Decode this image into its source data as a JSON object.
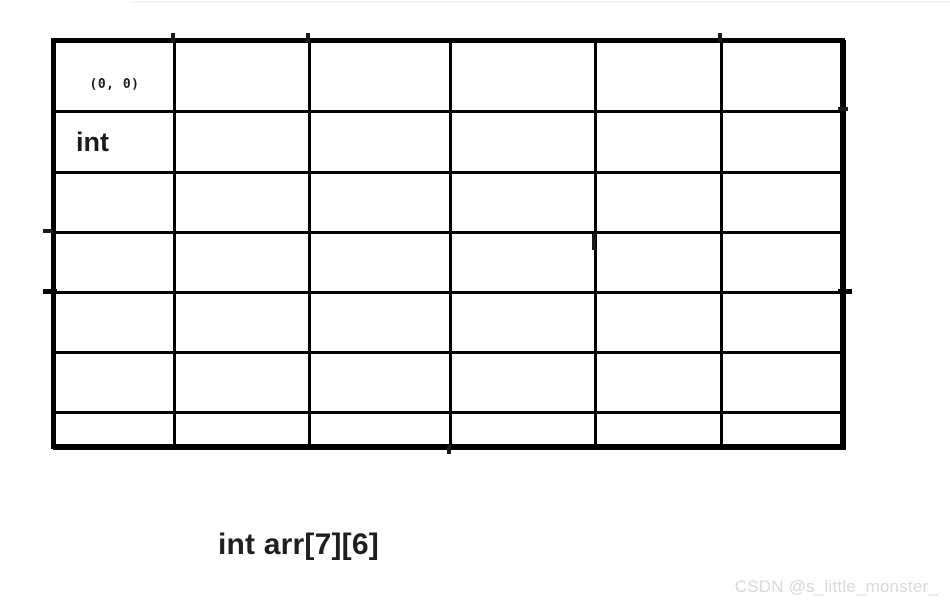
{
  "figure": {
    "caption": "int arr[7][6]",
    "watermark": "CSDN @s_little_monster_",
    "background_color": "#ffffff",
    "line_color": "#000000",
    "text_color": "#1b1b1b",
    "watermark_color": "#d6d9de"
  },
  "grid": {
    "rows": 7,
    "columns": 6,
    "origin_label": "(0, 0)",
    "type_label": "int",
    "cells": [
      [
        {
          "label": "(0, 0)",
          "style": "origin"
        },
        {
          "label": ""
        },
        {
          "label": ""
        },
        {
          "label": ""
        },
        {
          "label": ""
        },
        {
          "label": ""
        }
      ],
      [
        {
          "label": "int",
          "style": "type"
        },
        {
          "label": ""
        },
        {
          "label": ""
        },
        {
          "label": ""
        },
        {
          "label": ""
        },
        {
          "label": ""
        }
      ],
      [
        {
          "label": ""
        },
        {
          "label": ""
        },
        {
          "label": ""
        },
        {
          "label": ""
        },
        {
          "label": ""
        },
        {
          "label": ""
        }
      ],
      [
        {
          "label": ""
        },
        {
          "label": ""
        },
        {
          "label": ""
        },
        {
          "label": ""
        },
        {
          "label": ""
        },
        {
          "label": ""
        }
      ],
      [
        {
          "label": ""
        },
        {
          "label": ""
        },
        {
          "label": ""
        },
        {
          "label": ""
        },
        {
          "label": ""
        },
        {
          "label": ""
        }
      ],
      [
        {
          "label": ""
        },
        {
          "label": ""
        },
        {
          "label": ""
        },
        {
          "label": ""
        },
        {
          "label": ""
        },
        {
          "label": ""
        }
      ],
      [
        {
          "label": ""
        },
        {
          "label": ""
        },
        {
          "label": ""
        },
        {
          "label": ""
        },
        {
          "label": ""
        },
        {
          "label": ""
        }
      ]
    ]
  }
}
